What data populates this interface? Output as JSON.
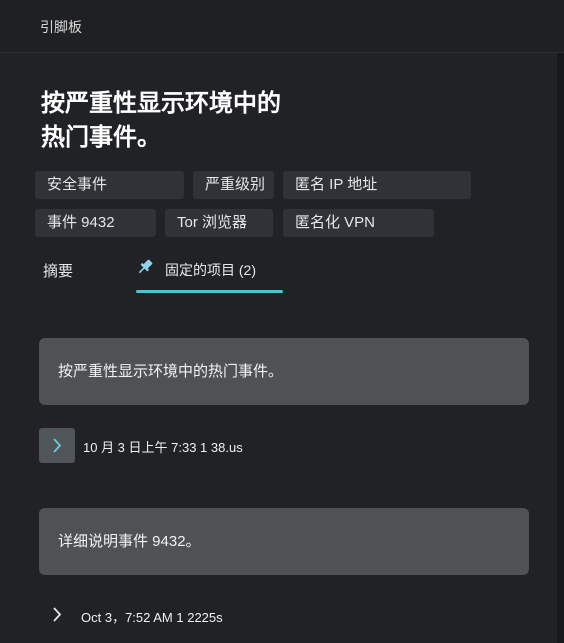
{
  "header": {
    "title": "引脚板"
  },
  "question": {
    "title": "按严重性显示环境中的热门事件。"
  },
  "chips": [
    {
      "label": "安全事件"
    },
    {
      "label": "严重级别"
    },
    {
      "label": "匿名 IP 地址"
    },
    {
      "label": "事件 9432"
    },
    {
      "label": "Tor 浏览器"
    },
    {
      "label": "匿名化 VPN"
    }
  ],
  "tabs": [
    {
      "label": "摘要"
    },
    {
      "label": "固定的项目 (2)",
      "icon": "pin-icon",
      "active": true
    }
  ],
  "pinned_items": [
    {
      "text": "按严重性显示环境中的热门事件。",
      "timestamp": "10 月 3 日上午 7:33 1 38.us",
      "expander": "chevron-right-icon"
    },
    {
      "text": "详细说明事件 9432。",
      "timestamp": "Oct 3，7:52 AM 1 2225s",
      "expander": "chevron-right-icon"
    }
  ],
  "colors": {
    "accent": "#49c5d3",
    "card": "#4f5255",
    "panel": "#202225"
  }
}
